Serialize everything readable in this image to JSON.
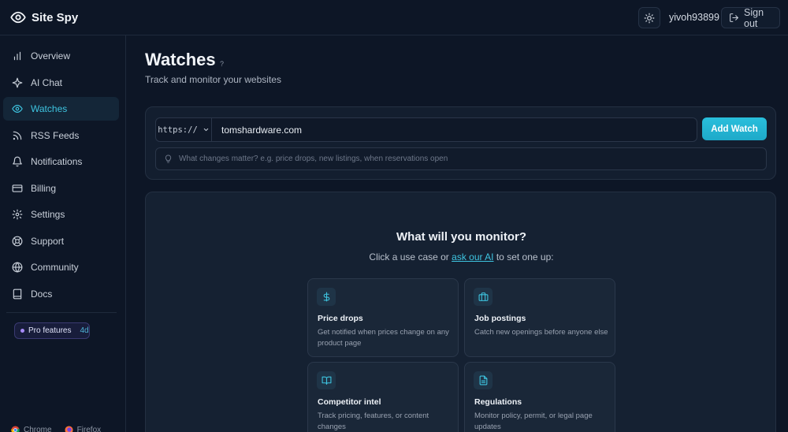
{
  "app": {
    "name": "Site Spy"
  },
  "header": {
    "username": "yivoh93899",
    "signout_label": "Sign out"
  },
  "sidebar": {
    "items": [
      {
        "label": "Overview",
        "icon": "bar-chart-icon",
        "active": false
      },
      {
        "label": "AI Chat",
        "icon": "sparkle-icon",
        "active": false
      },
      {
        "label": "Watches",
        "icon": "eye-icon",
        "active": true
      },
      {
        "label": "RSS Feeds",
        "icon": "rss-icon",
        "active": false
      },
      {
        "label": "Notifications",
        "icon": "bell-icon",
        "active": false
      },
      {
        "label": "Billing",
        "icon": "credit-card-icon",
        "active": false
      },
      {
        "label": "Settings",
        "icon": "gear-icon",
        "active": false
      },
      {
        "label": "Support",
        "icon": "lifebuoy-icon",
        "active": false
      },
      {
        "label": "Community",
        "icon": "globe-icon",
        "active": false
      },
      {
        "label": "Docs",
        "icon": "book-icon",
        "active": false
      }
    ],
    "pro": {
      "label": "Pro features",
      "days": "4d"
    },
    "browsers": [
      {
        "label": "Chrome"
      },
      {
        "label": "Firefox"
      }
    ]
  },
  "page": {
    "title": "Watches",
    "help": "?",
    "subtitle": "Track and monitor your websites"
  },
  "watch_form": {
    "protocol": "https://",
    "url_value": "tomshardware.com",
    "add_label": "Add Watch",
    "changes_placeholder": "What changes matter? e.g. price drops, new listings, when reservations open"
  },
  "monitor": {
    "title": "What will you monitor?",
    "subtitle_pre": "Click a use case or ",
    "subtitle_link": "ask our AI",
    "subtitle_post": " to set one up:",
    "use_cases": [
      {
        "title": "Price drops",
        "desc": "Get notified when prices change on any product page",
        "icon": "dollar-icon"
      },
      {
        "title": "Job postings",
        "desc": "Catch new openings before anyone else",
        "icon": "briefcase-icon"
      },
      {
        "title": "Competitor intel",
        "desc": "Track pricing, features, or content changes",
        "icon": "open-book-icon"
      },
      {
        "title": "Regulations",
        "desc": "Monitor policy, permit, or legal page updates",
        "icon": "document-icon"
      }
    ]
  },
  "colors": {
    "accent": "#3ec4e0",
    "background": "#0d1626",
    "card": "#152132",
    "pro": "#a78bfa"
  }
}
